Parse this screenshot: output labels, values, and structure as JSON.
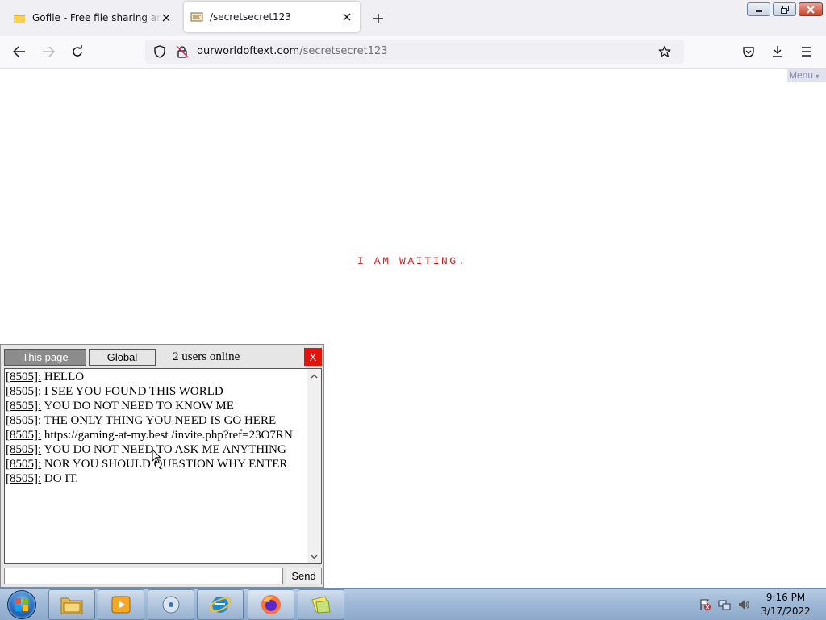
{
  "browser": {
    "tabs": [
      {
        "title": "Gofile - Free file sharing and storage",
        "favicon": "gofile-folder-icon",
        "active": false
      },
      {
        "title": "/secretsecret123",
        "favicon": "ourworldoftext-icon",
        "active": true
      }
    ],
    "address": {
      "host": "ourworldoftext.com",
      "path": "/secretsecret123"
    }
  },
  "page": {
    "menu_label": "Menu",
    "world_text": "I AM WAITING.",
    "text_color": "#cc1f1f"
  },
  "chat": {
    "tabs": {
      "this_page": "This page",
      "global": "Global"
    },
    "users_online": "2 users online",
    "close_label": "X",
    "messages": [
      {
        "id": "[8505]:",
        "text": " HELLO"
      },
      {
        "id": "[8505]:",
        "text": " I SEE YOU FOUND THIS WORLD"
      },
      {
        "id": "[8505]:",
        "text": " YOU DO NOT NEED TO KNOW ME"
      },
      {
        "id": "[8505]:",
        "text": " THE ONLY THING YOU NEED IS GO HERE"
      },
      {
        "id": "[8505]:",
        "text": " https://gaming-at-my.best /invite.php?ref=23O7RN"
      },
      {
        "id": "[8505]:",
        "text": " YOU DO NOT NEED TO ASK ME ANYTHING"
      },
      {
        "id": "[8505]:",
        "text": " NOR YOU SHOULD QUESTION WHY ENTER"
      },
      {
        "id": "[8505]:",
        "text": " DO IT."
      }
    ],
    "input_value": "",
    "send_label": "Send"
  },
  "taskbar": {
    "pinned": [
      "windows-explorer-icon",
      "media-player-icon",
      "media-center-icon",
      "internet-explorer-icon",
      "firefox-icon",
      "sticky-notes-icon"
    ],
    "clock": {
      "time": "9:16 PM",
      "date": "3/17/2022"
    }
  }
}
